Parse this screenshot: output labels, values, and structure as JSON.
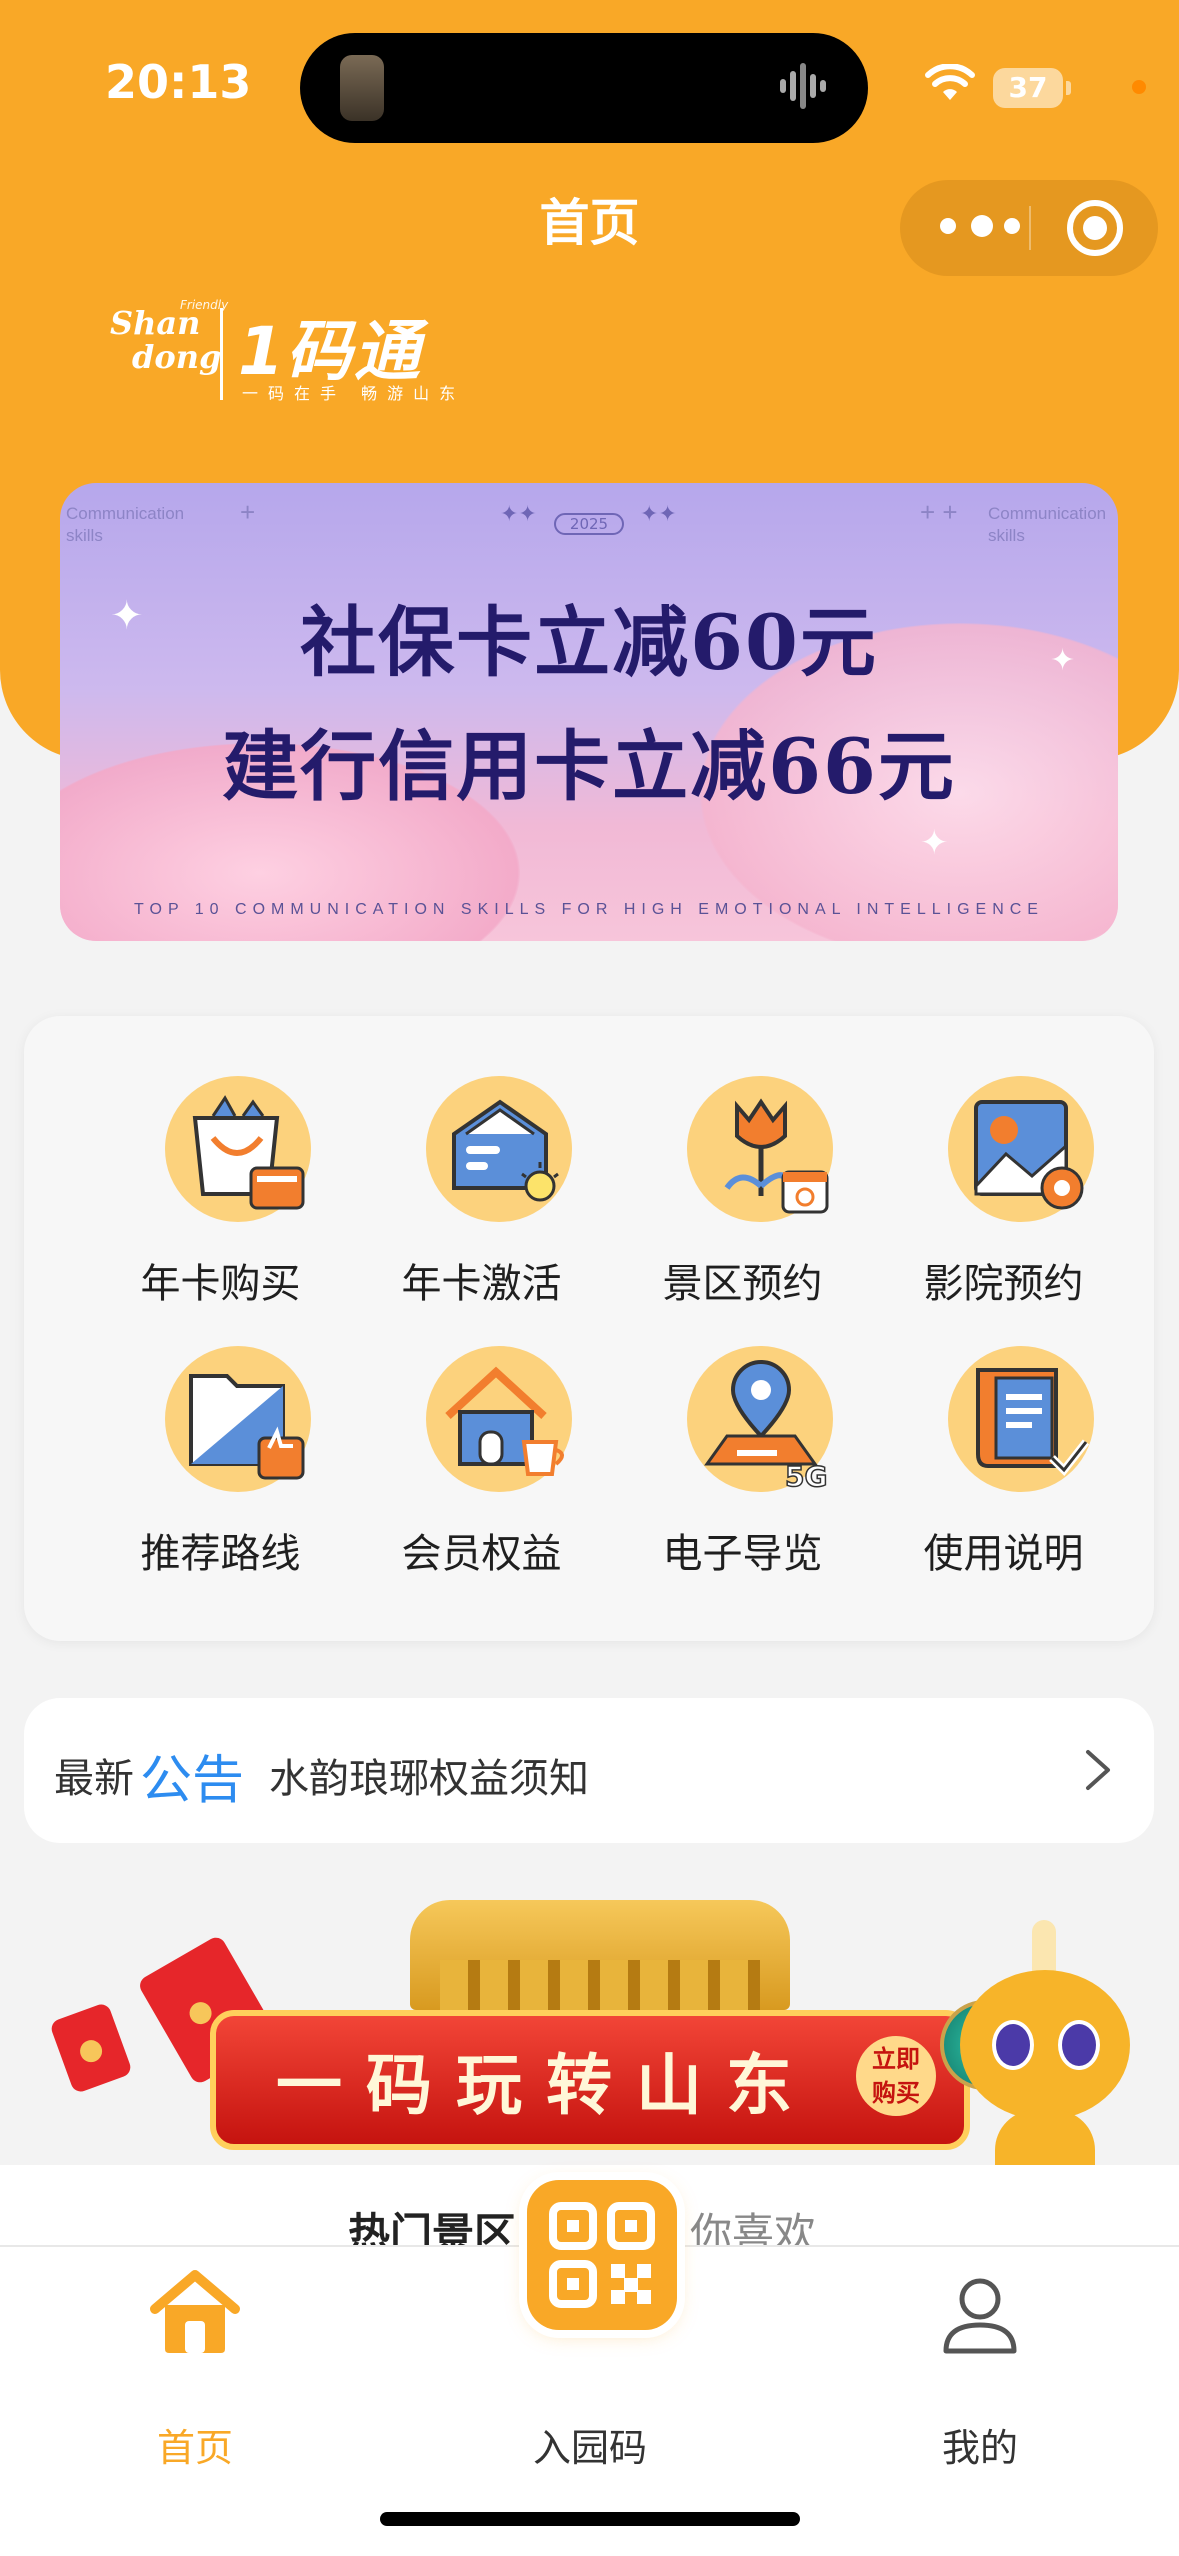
{
  "colors": {
    "brand": "#F9A827",
    "accent_blue": "#2D8CF0",
    "icon_bg": "#FCD27D",
    "icon_blue": "#5B8FD9",
    "icon_orange": "#F27E2E"
  },
  "status_bar": {
    "time": "20:13",
    "battery": "37"
  },
  "nav": {
    "title": "首页"
  },
  "logo": {
    "brand_en_1": "Shan",
    "brand_en_2": "dong",
    "brand_small": "Friendly",
    "main": "1码通",
    "slogan": "一码在手 畅游山东"
  },
  "banner": {
    "small_left": "Communication skills",
    "small_right": "Communication skills",
    "year": "2025",
    "line1": "社保卡立减60元",
    "line2": "建行信用卡立减66元",
    "footer": "TOP 10 COMMUNICATION SKILLS FOR HIGH EMOTIONAL INTELLIGENCE"
  },
  "grid": [
    {
      "label": "年卡购买",
      "icon": "shopping-bag-card-icon"
    },
    {
      "label": "年卡激活",
      "icon": "card-activate-icon"
    },
    {
      "label": "景区预约",
      "icon": "tulip-calendar-icon"
    },
    {
      "label": "影院预约",
      "icon": "picture-film-icon"
    },
    {
      "label": "推荐路线",
      "icon": "folder-thumbs-up-icon"
    },
    {
      "label": "会员权益",
      "icon": "house-coffee-icon"
    },
    {
      "label": "电子导览",
      "icon": "map-pin-5g-icon"
    },
    {
      "label": "使用说明",
      "icon": "document-check-icon"
    }
  ],
  "notice": {
    "prefix": "最新",
    "highlight": "公告",
    "text": "水韵琅琊权益须知"
  },
  "promo": {
    "title": "一码玩转山东",
    "badge_line1": "立即",
    "badge_line2": "购买"
  },
  "sections": {
    "hot": "热门景区",
    "like": "你喜欢"
  },
  "tabbar": [
    {
      "label": "首页",
      "icon": "home-icon",
      "active": true
    },
    {
      "label": "入园码",
      "icon": "qr-code-icon",
      "active": false
    },
    {
      "label": "我的",
      "icon": "user-icon",
      "active": false
    }
  ]
}
